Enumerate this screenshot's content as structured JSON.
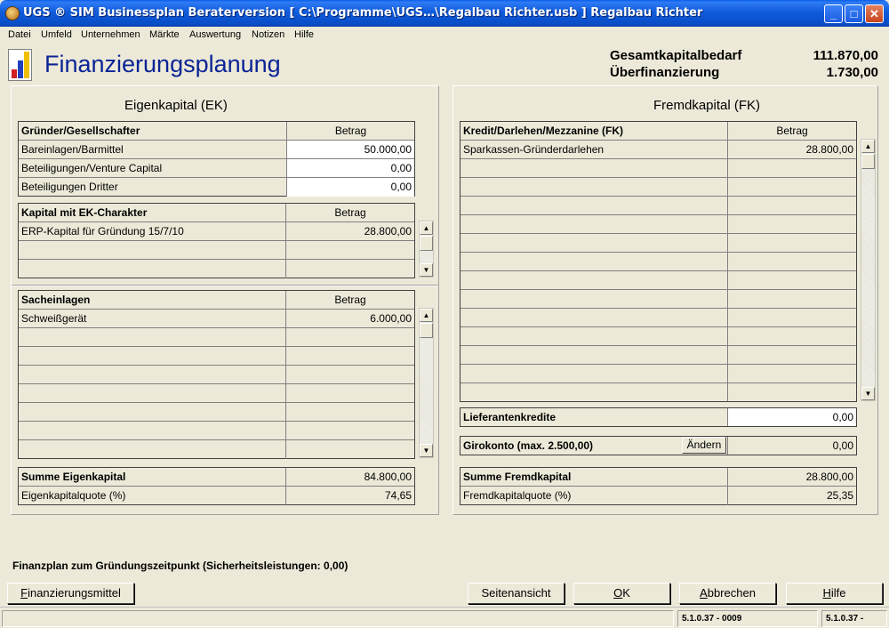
{
  "window": {
    "title": "UGS ® SIM Businessplan Beraterversion   [ C:\\Programme\\UGS…\\Regalbau Richter.usb ] Regalbau Richter",
    "min_glyph": "_",
    "max_glyph": "□",
    "close_glyph": "✕"
  },
  "menu": [
    "Datei",
    "Umfeld",
    "Unternehmen",
    "Märkte",
    "Auswertung",
    "Notizen",
    "Hilfe"
  ],
  "header": {
    "title": "Finanzierungsplanung",
    "gesamt_label": "Gesamtkapitalbedarf",
    "gesamt_value": "111.870,00",
    "ueber_label": "Überfinanzierung",
    "ueber_value": "1.730,00"
  },
  "ek": {
    "title": "Eigenkapital (EK)",
    "gruender": {
      "col1": "Gründer/Gesellschafter",
      "col2": "Betrag",
      "rows": [
        {
          "label": "Bareinlagen/Barmittel",
          "value": "50.000,00"
        },
        {
          "label": "Beteiligungen/Venture Capital",
          "value": "0,00"
        },
        {
          "label": "Beteiligungen Dritter",
          "value": "0,00"
        }
      ]
    },
    "ekcharakter": {
      "col1": "Kapital mit EK-Charakter",
      "col2": "Betrag",
      "rows": [
        {
          "label": "ERP-Kapital für Gründung 15/7/10",
          "value": "28.800,00"
        },
        {
          "label": "",
          "value": ""
        },
        {
          "label": "",
          "value": ""
        }
      ]
    },
    "sacheinlagen": {
      "col1": "Sacheinlagen",
      "col2": "Betrag",
      "rows": [
        {
          "label": "Schweißgerät",
          "value": "6.000,00"
        },
        {
          "label": "",
          "value": ""
        },
        {
          "label": "",
          "value": ""
        },
        {
          "label": "",
          "value": ""
        },
        {
          "label": "",
          "value": ""
        },
        {
          "label": "",
          "value": ""
        },
        {
          "label": "",
          "value": ""
        },
        {
          "label": "",
          "value": ""
        }
      ]
    },
    "summe": {
      "label": "Summe Eigenkapital",
      "value": "84.800,00",
      "quote_label": "Eigenkapitalquote (%)",
      "quote_value": "74,65"
    }
  },
  "fk": {
    "title": "Fremdkapital (FK)",
    "kredit": {
      "col1": "Kredit/Darlehen/Mezzanine (FK)",
      "col2": "Betrag",
      "rows": [
        {
          "label": "Sparkassen-Gründerdarlehen",
          "value": "28.800,00"
        },
        {
          "label": "",
          "value": ""
        },
        {
          "label": "",
          "value": ""
        },
        {
          "label": "",
          "value": ""
        },
        {
          "label": "",
          "value": ""
        },
        {
          "label": "",
          "value": ""
        },
        {
          "label": "",
          "value": ""
        },
        {
          "label": "",
          "value": ""
        },
        {
          "label": "",
          "value": ""
        },
        {
          "label": "",
          "value": ""
        },
        {
          "label": "",
          "value": ""
        },
        {
          "label": "",
          "value": ""
        },
        {
          "label": "",
          "value": ""
        },
        {
          "label": "",
          "value": ""
        }
      ]
    },
    "lieferanten": {
      "label": "Lieferantenkredite",
      "value": "0,00"
    },
    "giro": {
      "label": "Girokonto (max. 2.500,00)",
      "button": "Ändern",
      "value": "0,00"
    },
    "summe": {
      "label": "Summe Fremdkapital",
      "value": "28.800,00",
      "quote_label": "Fremdkapitalquote (%)",
      "quote_value": "25,35"
    }
  },
  "bottom_text": "Finanzplan zum Gründungszeitpunkt (Sicherheitsleistungen: 0,00)",
  "buttons": {
    "finanzierungsmittel": {
      "first": "F",
      "rest": "inanzierungsmittel"
    },
    "seitenansicht": "Seitenansicht",
    "ok": {
      "first": "O",
      "rest": "K"
    },
    "abbrechen": {
      "first": "A",
      "rest": "bbrechen"
    },
    "hilfe": {
      "first": "H",
      "rest": "ilfe"
    }
  },
  "status": {
    "pane1": "5.1.0.37 - 0009",
    "pane2": "5.1.0.37 -"
  },
  "scroll_glyphs": {
    "up": "▲",
    "down": "▼"
  },
  "colors": {
    "title_bar": "#0A4EC7",
    "accent_title": "#0b2496",
    "face": "#ECE9D8"
  }
}
